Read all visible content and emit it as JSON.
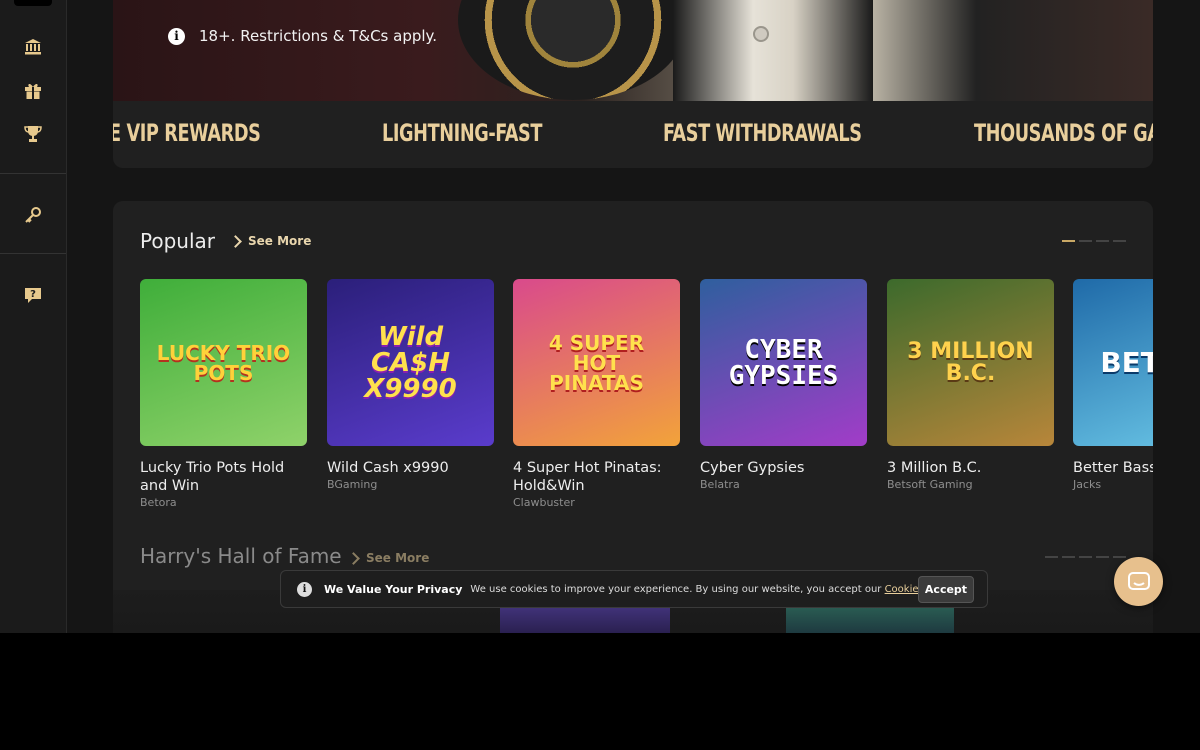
{
  "hero": {
    "notice": "18+. Restrictions & T&Cs apply.",
    "info_icon": "i"
  },
  "ticker": [
    "E VIP REWARDS",
    "LIGHTNING-FAST",
    "FAST WITHDRAWALS",
    "THOUSANDS OF GAMES"
  ],
  "sidebar": {
    "icons": [
      "bank-icon",
      "gift-icon",
      "trophy-icon",
      "key-icon",
      "help-icon"
    ]
  },
  "popular": {
    "title": "Popular",
    "see_more": "See More",
    "games": [
      {
        "name": "Lucky Trio Pots Hold and Win",
        "provider": "Betora",
        "logo": "LUCKY TRIO POTS",
        "colors": [
          "#3fae3a",
          "#8fd26a"
        ]
      },
      {
        "name": "Wild Cash x9990",
        "provider": "BGaming",
        "logo": "Wild CA$H X9990",
        "colors": [
          "#2b1f7a",
          "#5a3ccc"
        ]
      },
      {
        "name": "4 Super Hot Pinatas: Hold&Win",
        "provider": "Clawbuster",
        "logo": "4 SUPER HOT PINATAS",
        "colors": [
          "#d94a8c",
          "#f2a33a"
        ]
      },
      {
        "name": "Cyber Gypsies",
        "provider": "Belatra",
        "logo": "CYBER GYPSIES",
        "colors": [
          "#2f5f9e",
          "#a23cc8"
        ]
      },
      {
        "name": "3 Million B.C.",
        "provider": "Betsoft Gaming",
        "logo": "3 MILLION B.C.",
        "colors": [
          "#3c6a2c",
          "#b8863a"
        ]
      },
      {
        "name": "Better Bass",
        "provider": "Jacks",
        "logo": "BET BA",
        "colors": [
          "#1f6aa8",
          "#6cc8e8"
        ]
      }
    ]
  },
  "hall_of_fame": {
    "title": "Harry's Hall of Fame",
    "see_more": "See More"
  },
  "cookie": {
    "title": "We Value Your Privacy",
    "text": "We use cookies to improve your experience. By using our website, you accept our",
    "link": "Cookie Policy",
    "accept": "Accept"
  }
}
